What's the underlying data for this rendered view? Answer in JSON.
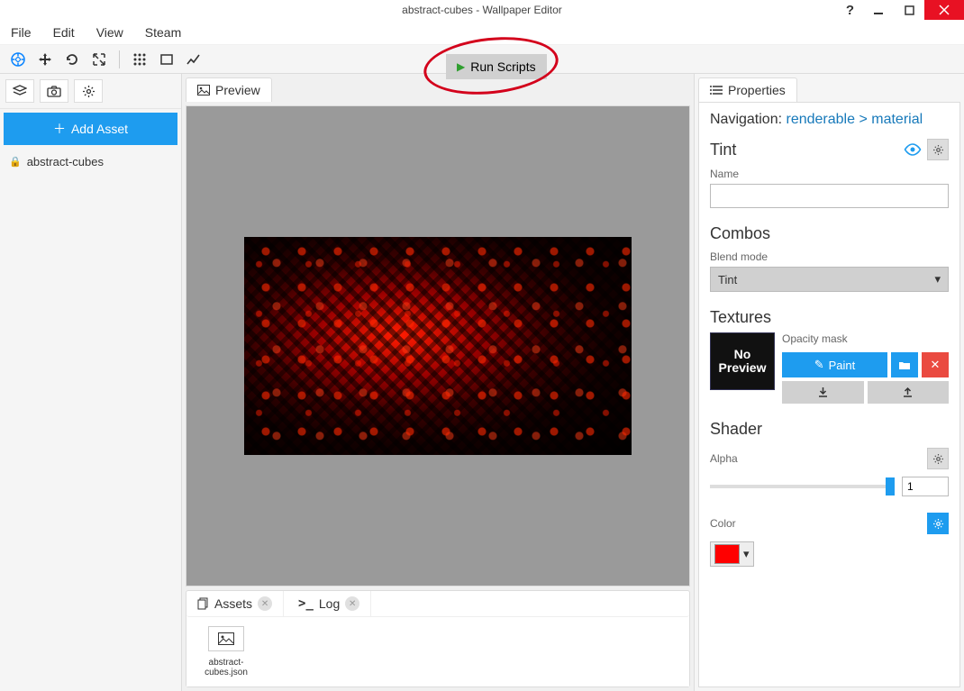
{
  "titlebar": {
    "title": "abstract-cubes - Wallpaper Editor"
  },
  "menubar": {
    "file": "File",
    "edit": "Edit",
    "view": "View",
    "steam": "Steam"
  },
  "toolbar": {
    "run_scripts": "Run Scripts"
  },
  "sidebar": {
    "add_asset": "Add Asset",
    "items": [
      {
        "name": "abstract-cubes"
      }
    ]
  },
  "center": {
    "preview_tab": "Preview",
    "assets_tab": "Assets",
    "log_tab": "Log",
    "asset_file": "abstract-cubes.json"
  },
  "properties": {
    "tab": "Properties",
    "nav_label": "Navigation:",
    "nav_renderable": "renderable",
    "nav_sep": ">",
    "nav_material": "material",
    "tint_section": "Tint",
    "name_label": "Name",
    "name_value": "",
    "combos_section": "Combos",
    "blend_mode_label": "Blend mode",
    "blend_mode_value": "Tint",
    "textures_section": "Textures",
    "no_preview": "No Preview",
    "opacity_mask_label": "Opacity mask",
    "paint_btn": "Paint",
    "shader_section": "Shader",
    "alpha_label": "Alpha",
    "alpha_value": "1",
    "color_label": "Color",
    "color_value": "#ff0000"
  }
}
